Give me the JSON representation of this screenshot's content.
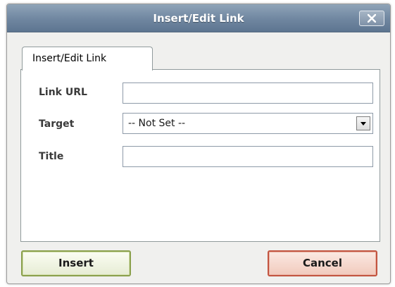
{
  "dialog": {
    "title": "Insert/Edit Link",
    "close_icon": "close-icon"
  },
  "tabs": [
    {
      "label": "Insert/Edit Link",
      "active": true
    }
  ],
  "form": {
    "link_url": {
      "label": "Link URL",
      "value": ""
    },
    "target": {
      "label": "Target",
      "selected": "-- Not Set --",
      "arrow_icon": "chevron-down-icon"
    },
    "title": {
      "label": "Title",
      "value": ""
    }
  },
  "buttons": {
    "insert": "Insert",
    "cancel": "Cancel"
  },
  "colors": {
    "titlebar": "#6f86a0",
    "insert_border": "#8aa04c",
    "cancel_border": "#c25440"
  }
}
